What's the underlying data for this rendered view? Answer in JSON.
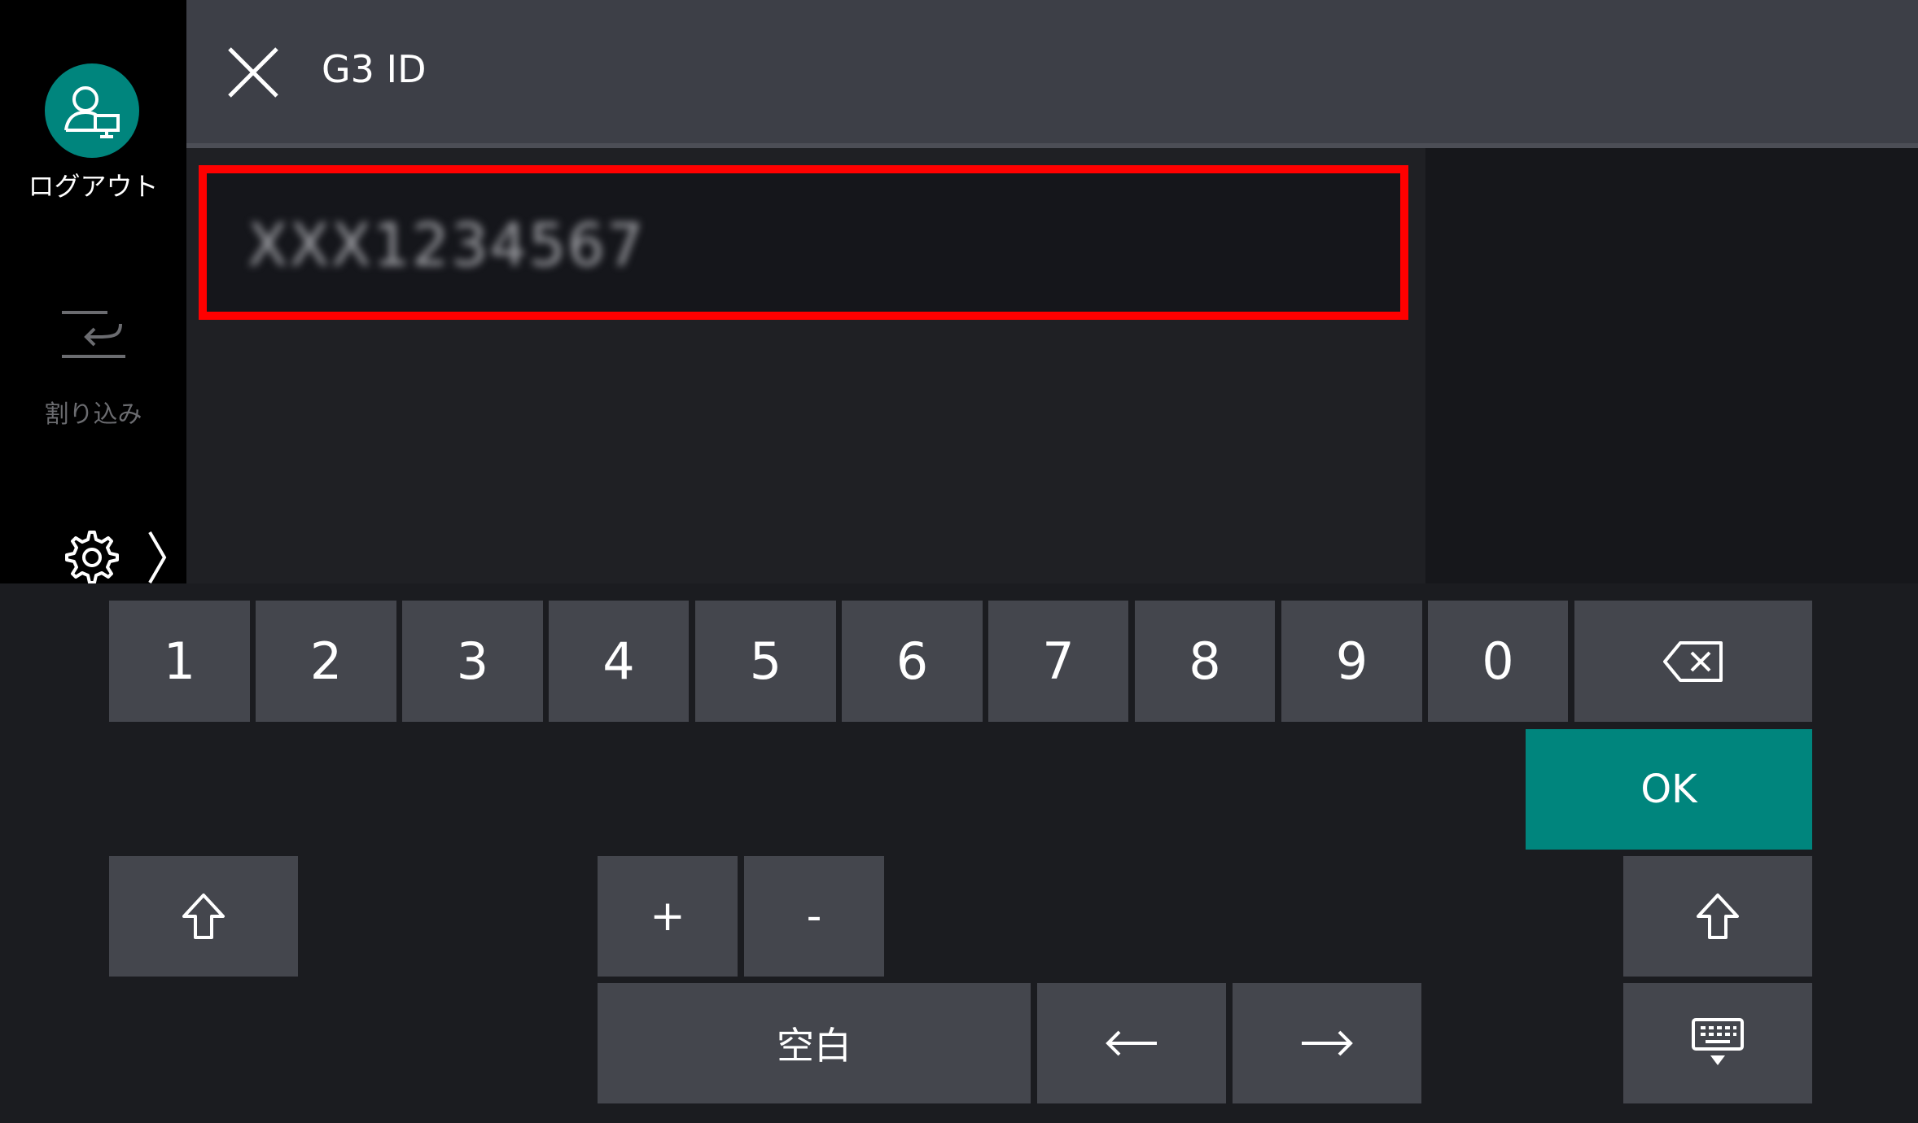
{
  "sidebar": {
    "logout_label": "ログアウト",
    "interrupt_label": "割り込み"
  },
  "header": {
    "title": "G3  ID"
  },
  "input": {
    "value": "XXX1234567"
  },
  "keyboard": {
    "digits": [
      "1",
      "2",
      "3",
      "4",
      "5",
      "6",
      "7",
      "8",
      "9",
      "0"
    ],
    "ok_label": "OK",
    "plus_label": "+",
    "minus_label": "-",
    "space_label": "空白"
  },
  "colors": {
    "accent": "#00857d",
    "highlight_border": "#ff0000"
  }
}
